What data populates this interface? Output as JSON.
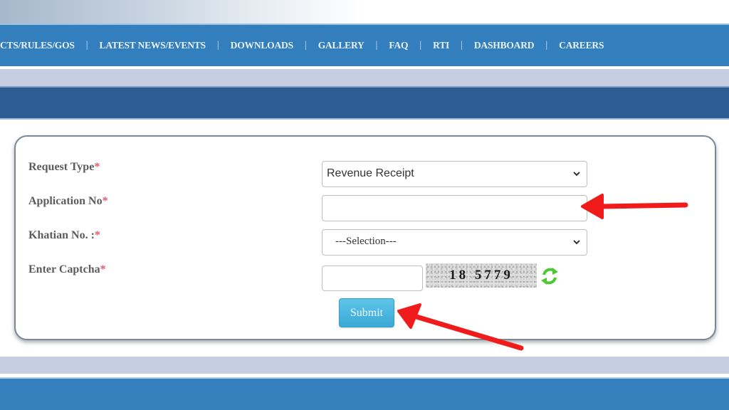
{
  "nav": {
    "items": [
      {
        "label": "CTS/RULES/GOS"
      },
      {
        "label": "LATEST NEWS/EVENTS"
      },
      {
        "label": "DOWNLOADS"
      },
      {
        "label": "GALLERY"
      },
      {
        "label": "FAQ"
      },
      {
        "label": "RTI"
      },
      {
        "label": "DASHBOARD"
      },
      {
        "label": "CAREERS"
      }
    ],
    "separator": "|"
  },
  "form": {
    "fields": [
      {
        "label": "Request Type",
        "required_mark": "*",
        "type": "select",
        "value": "Revenue Receipt"
      },
      {
        "label": "Application No",
        "required_mark": "*",
        "type": "text",
        "value": "",
        "placeholder": ""
      },
      {
        "label": "Khatian No. :",
        "required_mark": "*",
        "type": "select",
        "value": "---Selection---"
      },
      {
        "label": "Enter Captcha",
        "required_mark": "*",
        "type": "captcha",
        "value": "",
        "captcha_code": "18 5779"
      }
    ],
    "submit_label": "Submit",
    "refresh_icon": "refresh-icon"
  },
  "colors": {
    "nav_bg": "#337fbd",
    "header_dark": "#2d5b92",
    "strip_light": "#c6cfe2",
    "label_text": "#5c5c5c",
    "required": "#e05a6a",
    "submit_bg": "#4bb6df",
    "annotation_arrow": "#f01c1c",
    "refresh_green": "#4cc832"
  },
  "annotations": [
    {
      "type": "arrow",
      "points_to": "application-no-input"
    },
    {
      "type": "arrow",
      "points_to": "submit-button"
    }
  ]
}
